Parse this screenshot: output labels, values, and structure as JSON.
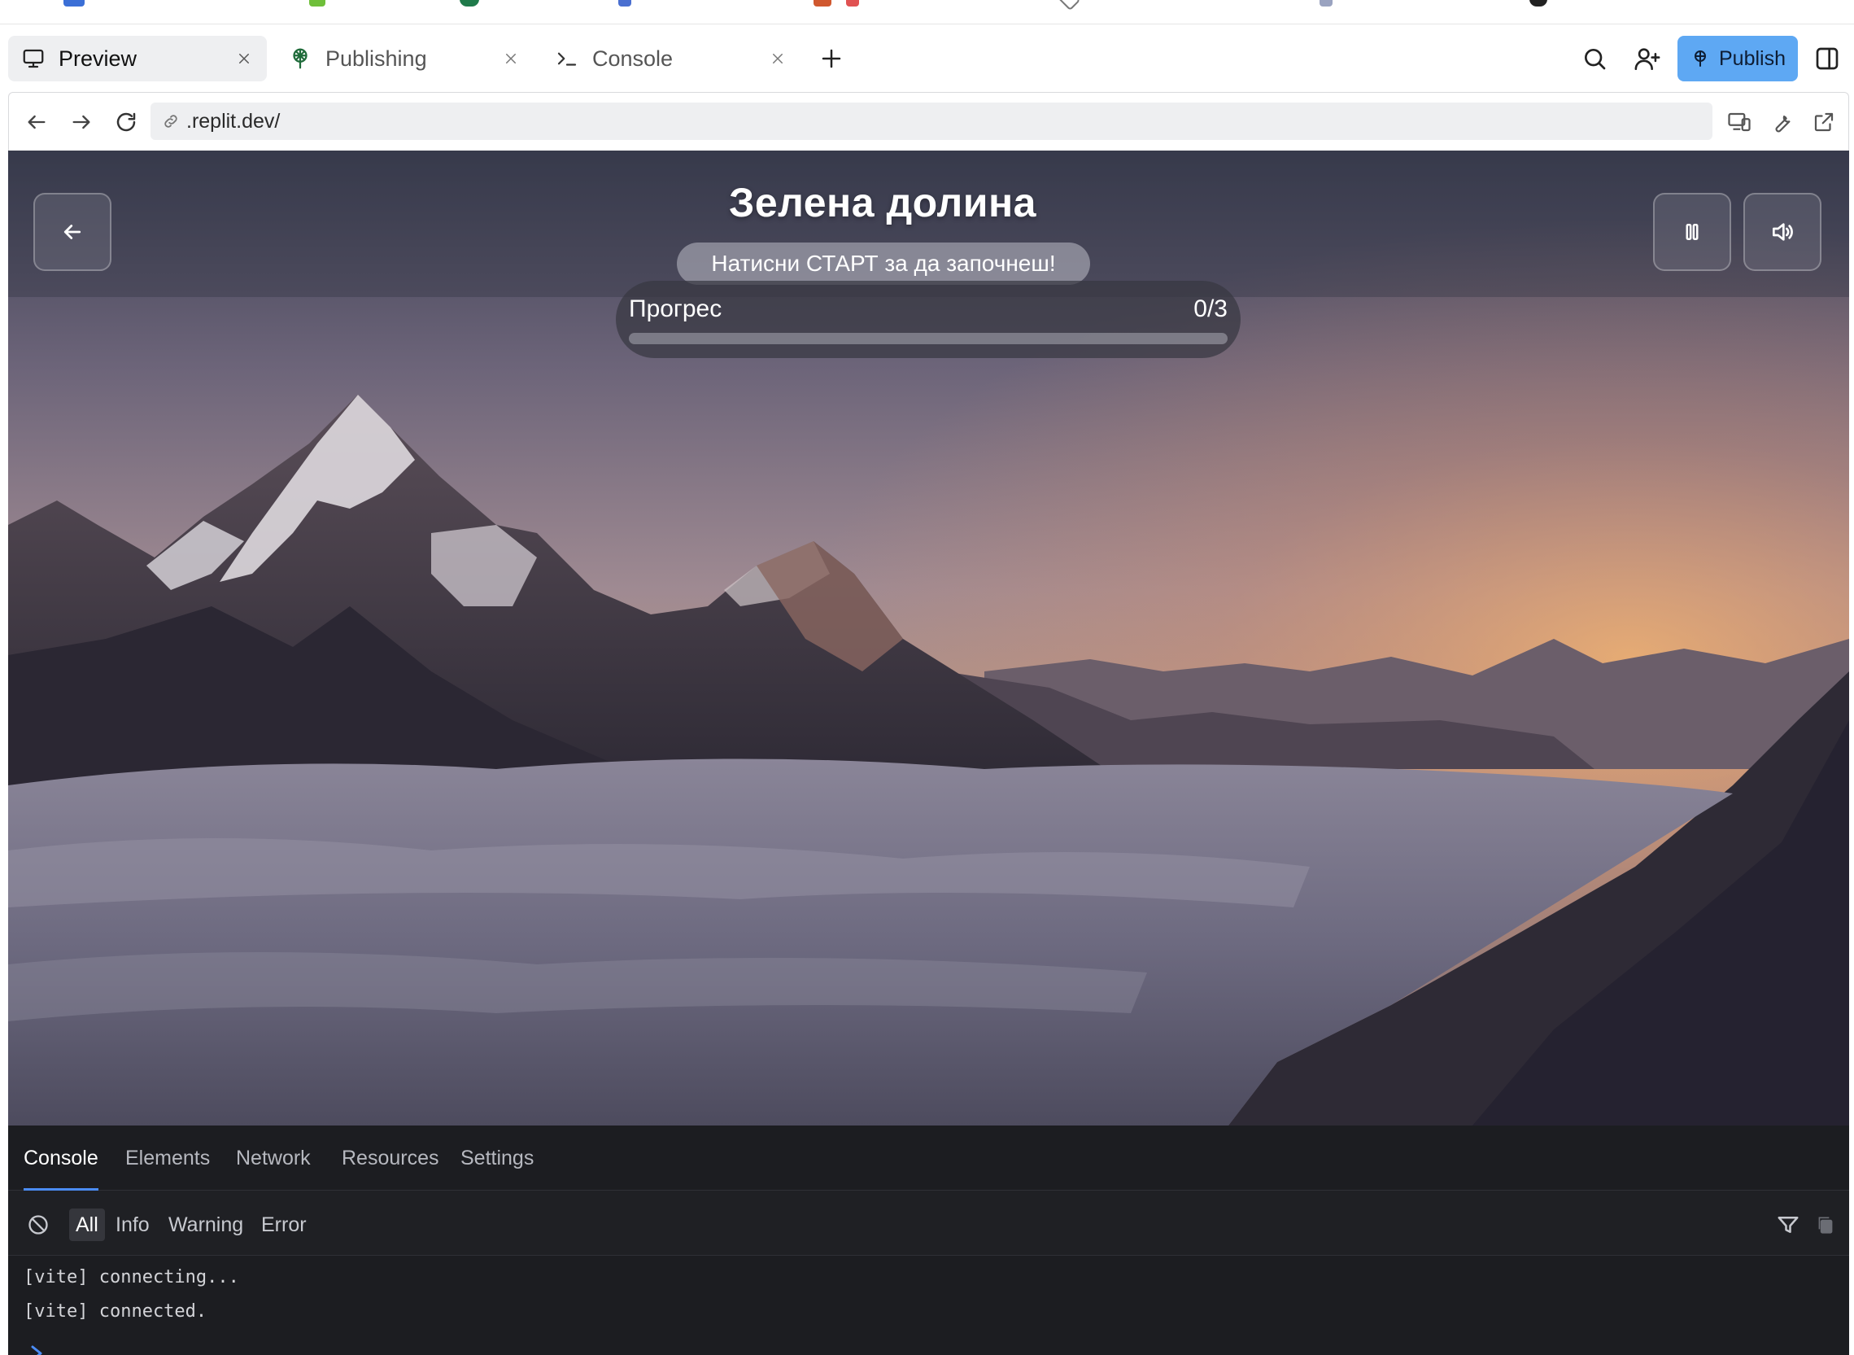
{
  "tabs": [
    {
      "label": "Preview",
      "icon": "monitor-icon",
      "active": true
    },
    {
      "label": "Publishing",
      "icon": "publishing-icon",
      "active": false
    },
    {
      "label": "Console",
      "icon": "terminal-icon",
      "active": false
    }
  ],
  "toolbar": {
    "publish_label": "Publish",
    "publish_color": "#5ea8f3"
  },
  "address": {
    "url": ".replit.dev/"
  },
  "game": {
    "title": "Зелена долина",
    "hint": "Натисни СТАРТ за да започнеш!",
    "progress_label": "Прогрес",
    "progress_count": "0/3",
    "progress_value": 0
  },
  "devtools": {
    "tabs": [
      "Console",
      "Elements",
      "Network",
      "Resources",
      "Settings"
    ],
    "active_tab": "Console",
    "filters": [
      "All",
      "Info",
      "Warning",
      "Error"
    ],
    "active_filter": "All",
    "logs": [
      "[vite] connecting...",
      "[vite] connected."
    ]
  },
  "colors": {
    "accent": "#4b8cf5",
    "devtools_bg": "#1c1d21"
  }
}
